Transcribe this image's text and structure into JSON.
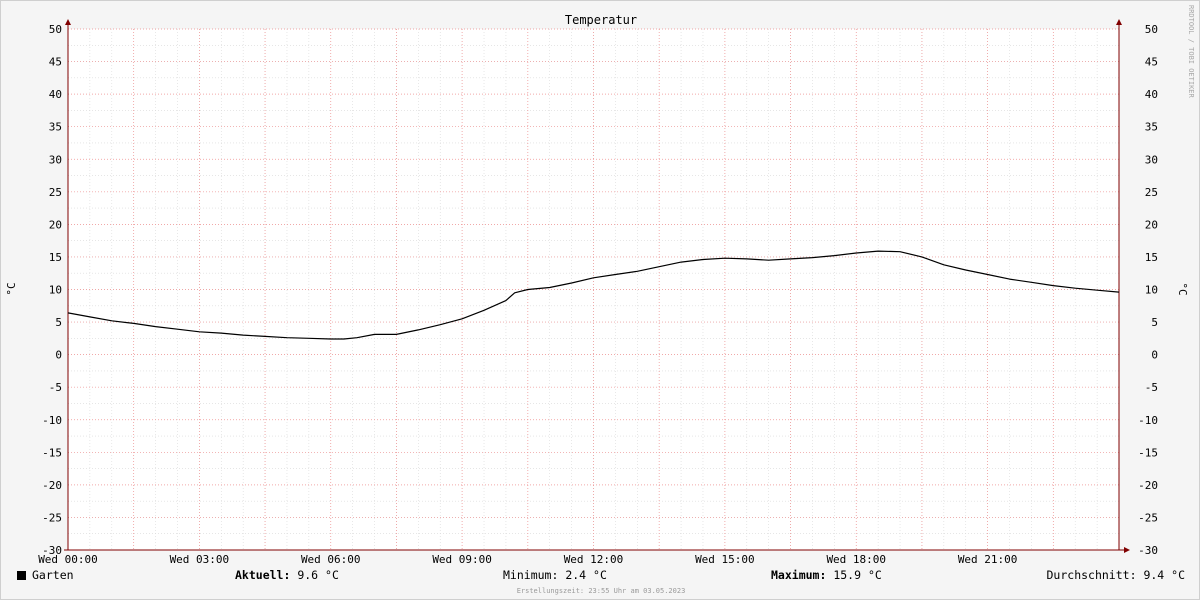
{
  "chart_data": {
    "type": "line",
    "title": "Temperatur",
    "ylabel_left": "°C",
    "ylabel_right": "°C",
    "ylim": [
      -30,
      50
    ],
    "y_ticks": [
      50,
      45,
      40,
      35,
      30,
      25,
      20,
      15,
      10,
      5,
      0,
      -5,
      -10,
      -15,
      -20,
      -25,
      -30
    ],
    "x_range_hours": [
      0,
      24
    ],
    "x_ticks": [
      {
        "hour": 0,
        "label": "Wed 00:00"
      },
      {
        "hour": 3,
        "label": "Wed 03:00"
      },
      {
        "hour": 6,
        "label": "Wed 06:00"
      },
      {
        "hour": 9,
        "label": "Wed 09:00"
      },
      {
        "hour": 12,
        "label": "Wed 12:00"
      },
      {
        "hour": 15,
        "label": "Wed 15:00"
      },
      {
        "hour": 18,
        "label": "Wed 18:00"
      },
      {
        "hour": 21,
        "label": "Wed 21:00"
      }
    ],
    "series": [
      {
        "name": "Garten",
        "color": "#000000",
        "x": [
          0,
          0.5,
          1,
          1.5,
          2,
          2.5,
          3,
          3.5,
          4,
          4.5,
          5,
          5.5,
          6,
          6.3,
          6.6,
          7,
          7.5,
          8,
          8.5,
          9,
          9.5,
          10,
          10.2,
          10.5,
          11,
          11.5,
          12,
          12.5,
          13,
          13.5,
          14,
          14.5,
          15,
          15.5,
          16,
          16.5,
          17,
          17.5,
          18,
          18.5,
          19,
          19.5,
          20,
          20.5,
          21,
          21.5,
          22,
          22.5,
          23,
          23.5,
          24
        ],
        "y": [
          6.4,
          5.8,
          5.2,
          4.8,
          4.3,
          3.9,
          3.5,
          3.3,
          3.0,
          2.8,
          2.6,
          2.5,
          2.4,
          2.4,
          2.6,
          3.1,
          3.1,
          3.8,
          4.6,
          5.5,
          6.8,
          8.3,
          9.5,
          10.0,
          10.3,
          11.0,
          11.8,
          12.3,
          12.8,
          13.5,
          14.2,
          14.6,
          14.8,
          14.7,
          14.5,
          14.7,
          14.9,
          15.2,
          15.6,
          15.9,
          15.8,
          15.0,
          13.8,
          13.0,
          12.3,
          11.6,
          11.1,
          10.6,
          10.2,
          9.9,
          9.6
        ]
      }
    ],
    "grid": true,
    "stats": {
      "current_label": "Aktuell:",
      "current_value": "9.6 °C",
      "min_label": "Minimum:",
      "min_value": "2.4 °C",
      "max_label": "Maximum:",
      "max_value": "15.9 °C",
      "avg_label": "Durchschnitt:",
      "avg_value": "9.4 °C"
    }
  },
  "watermark": "RRDTOOL / TOBI OETIKER",
  "footer": "Erstellungszeit: 23:55 Uhr am 03.05.2023",
  "colors": {
    "major_grid": "#f09090",
    "minor_grid": "#d8d8d8",
    "axis": "#800000",
    "line": "#000000",
    "background": "#f5f5f5",
    "canvas": "#ffffff"
  }
}
